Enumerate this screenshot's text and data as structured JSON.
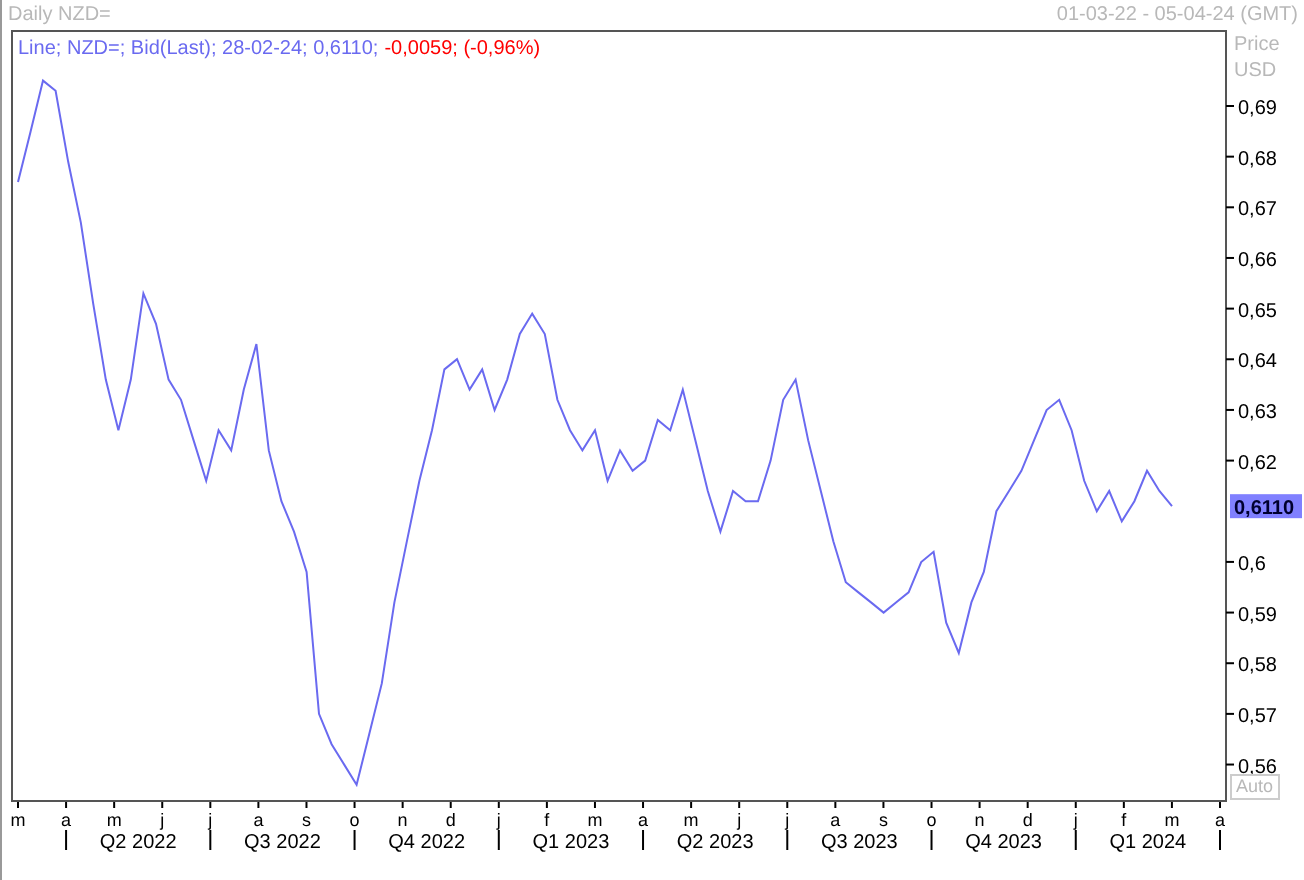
{
  "window": {
    "title": "Daily NZD="
  },
  "date_range": "01-03-22 - 05-04-24 (GMT)",
  "legend": {
    "prefix": "Line; ",
    "info": "; Bid(Last); 28-02-24; 0,6110;",
    "change": "-0,0059; (-0,96%)"
  },
  "axis_title": [
    "Price",
    "USD"
  ],
  "last_value": "0,6110",
  "auto_button": "Auto",
  "months": [
    "m",
    "a",
    "m",
    "j",
    "j",
    "a",
    "s",
    "o",
    "n",
    "d",
    "j",
    "f",
    "m",
    "a",
    "m",
    "j",
    "j",
    "a",
    "s",
    "o",
    "n",
    "d",
    "j",
    "f",
    "m",
    "a"
  ],
  "quarters": [
    "Q2 2022",
    "Q3 2022",
    "Q4 2022",
    "Q1 2023",
    "Q2 2023",
    "Q3 2023",
    "Q4 2023",
    "Q1 2024"
  ],
  "chart_data": {
    "type": "line",
    "ylim": [
      0.553,
      0.705
    ],
    "yticks": [
      {
        "value": 0.69,
        "label": "0,69"
      },
      {
        "value": 0.68,
        "label": "0,68"
      },
      {
        "value": 0.67,
        "label": "0,67"
      },
      {
        "value": 0.66,
        "label": "0,66"
      },
      {
        "value": 0.65,
        "label": "0,65"
      },
      {
        "value": 0.64,
        "label": "0,64"
      },
      {
        "value": 0.63,
        "label": "0,63"
      },
      {
        "value": 0.62,
        "label": "0,62"
      },
      {
        "value": 0.6,
        "label": "0,6"
      },
      {
        "value": 0.59,
        "label": "0,59"
      },
      {
        "value": 0.58,
        "label": "0,58"
      },
      {
        "value": 0.57,
        "label": "0,57"
      },
      {
        "value": 0.56,
        "label": "0,56"
      }
    ],
    "series": [
      {
        "name": "NZD=",
        "color": "#6a6af0",
        "values": [
          0.675,
          0.685,
          0.695,
          0.693,
          0.679,
          0.667,
          0.651,
          0.636,
          0.626,
          0.636,
          0.653,
          0.647,
          0.636,
          0.632,
          0.624,
          0.616,
          0.626,
          0.622,
          0.634,
          0.643,
          0.622,
          0.612,
          0.606,
          0.598,
          0.57,
          0.564,
          0.56,
          0.556,
          0.566,
          0.576,
          0.592,
          0.604,
          0.616,
          0.626,
          0.638,
          0.64,
          0.634,
          0.638,
          0.63,
          0.636,
          0.645,
          0.649,
          0.645,
          0.632,
          0.626,
          0.622,
          0.626,
          0.616,
          0.622,
          0.618,
          0.62,
          0.628,
          0.626,
          0.634,
          0.624,
          0.614,
          0.606,
          0.614,
          0.612,
          0.612,
          0.62,
          0.632,
          0.636,
          0.624,
          0.614,
          0.604,
          0.596,
          0.594,
          0.592,
          0.59,
          0.592,
          0.594,
          0.6,
          0.602,
          0.588,
          0.582,
          0.592,
          0.598,
          0.61,
          0.614,
          0.618,
          0.624,
          0.63,
          0.632,
          0.626,
          0.616,
          0.61,
          0.614,
          0.608,
          0.612,
          0.618,
          0.614,
          0.611
        ]
      }
    ]
  }
}
